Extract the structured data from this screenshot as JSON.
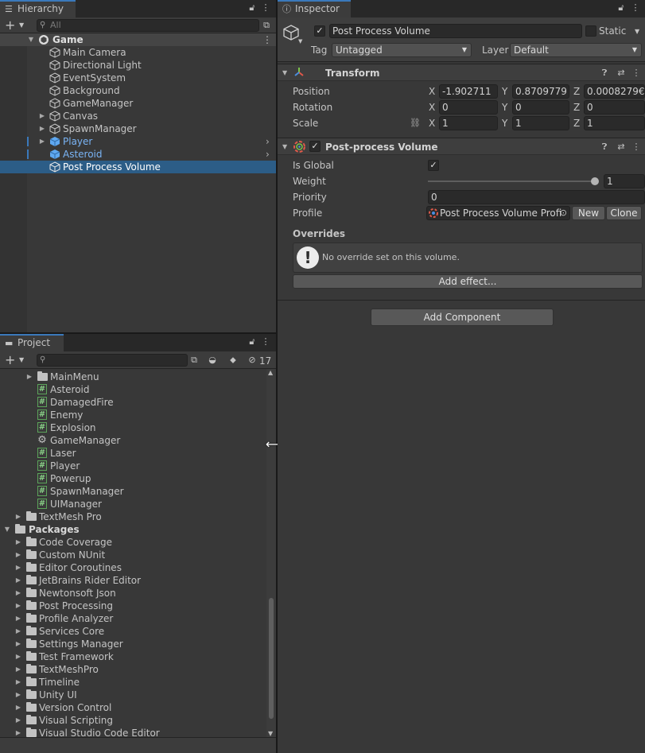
{
  "hierarchy": {
    "tab_label": "Hierarchy",
    "search_placeholder": "All",
    "scene": "Game",
    "items": [
      {
        "label": "Main Camera"
      },
      {
        "label": "Directional Light"
      },
      {
        "label": "EventSystem"
      },
      {
        "label": "Background"
      },
      {
        "label": "GameManager"
      },
      {
        "label": "Canvas"
      },
      {
        "label": "SpawnManager"
      },
      {
        "label": "Player"
      },
      {
        "label": "Asteroid"
      },
      {
        "label": "Post Process Volume"
      }
    ]
  },
  "project": {
    "tab_label": "Project",
    "hidden_count": "17",
    "items": [
      {
        "label": "MainMenu"
      },
      {
        "label": "Asteroid"
      },
      {
        "label": "DamagedFire"
      },
      {
        "label": "Enemy"
      },
      {
        "label": "Explosion"
      },
      {
        "label": "GameManager"
      },
      {
        "label": "Laser"
      },
      {
        "label": "Player"
      },
      {
        "label": "Powerup"
      },
      {
        "label": "SpawnManager"
      },
      {
        "label": "UIManager"
      },
      {
        "label": "TextMesh Pro"
      },
      {
        "label": "Packages"
      },
      {
        "label": "Code Coverage"
      },
      {
        "label": "Custom NUnit"
      },
      {
        "label": "Editor Coroutines"
      },
      {
        "label": "JetBrains Rider Editor"
      },
      {
        "label": "Newtonsoft Json"
      },
      {
        "label": "Post Processing"
      },
      {
        "label": "Profile Analyzer"
      },
      {
        "label": "Services Core"
      },
      {
        "label": "Settings Manager"
      },
      {
        "label": "Test Framework"
      },
      {
        "label": "TextMeshPro"
      },
      {
        "label": "Timeline"
      },
      {
        "label": "Unity UI"
      },
      {
        "label": "Version Control"
      },
      {
        "label": "Visual Scripting"
      },
      {
        "label": "Visual Studio Code Editor"
      }
    ]
  },
  "inspector": {
    "tab_label": "Inspector",
    "object_name": "Post Process Volume",
    "static_label": "Static",
    "tag_label": "Tag",
    "tag_value": "Untagged",
    "layer_label": "Layer",
    "layer_value": "Default",
    "transform": {
      "title": "Transform",
      "position_label": "Position",
      "rotation_label": "Rotation",
      "scale_label": "Scale",
      "axis_x": "X",
      "axis_y": "Y",
      "axis_z": "Z",
      "position": {
        "x": "-1.902711",
        "y": "0.8709779",
        "z": "0.0008279€"
      },
      "rotation": {
        "x": "0",
        "y": "0",
        "z": "0"
      },
      "scale": {
        "x": "1",
        "y": "1",
        "z": "1"
      }
    },
    "ppv": {
      "title": "Post-process Volume",
      "is_global_label": "Is Global",
      "weight_label": "Weight",
      "weight_value": "1",
      "priority_label": "Priority",
      "priority_value": "0",
      "profile_label": "Profile",
      "profile_value": "Post Process Volume Profi",
      "new_label": "New",
      "clone_label": "Clone",
      "overrides_label": "Overrides",
      "no_override_text": "No override set on this volume.",
      "add_effect_label": "Add effect..."
    },
    "add_component_label": "Add Component"
  },
  "colors": {
    "accent": "#3a79bb",
    "selection": "#2c5d87",
    "prefab_blue": "#7ab4f5",
    "script_green": "#5ca45a"
  }
}
